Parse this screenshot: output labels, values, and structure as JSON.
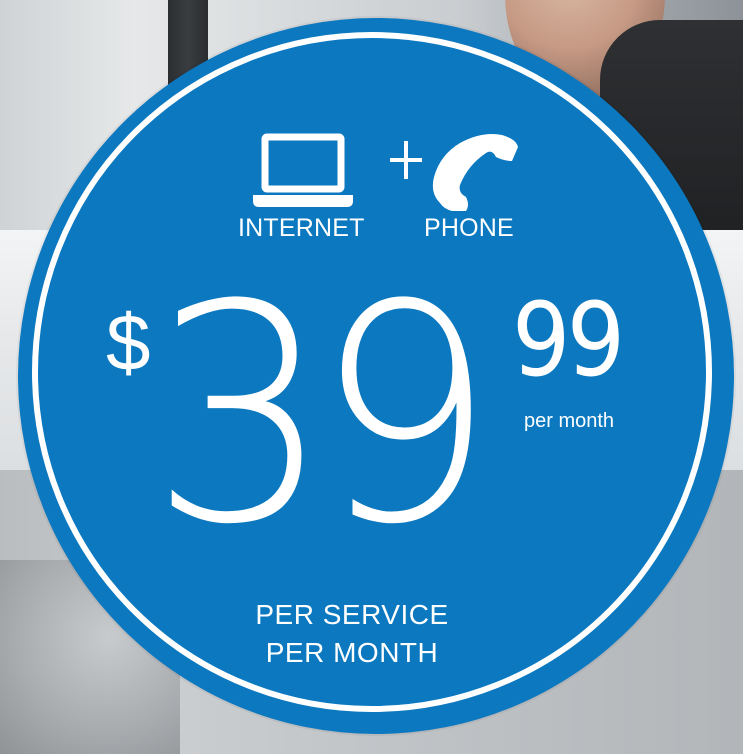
{
  "badge": {
    "icon_left": "laptop-icon",
    "icon_right": "phone-icon",
    "plus_sign": "+",
    "label_left": "INTERNET",
    "label_right": "PHONE",
    "currency": "$",
    "price_whole": "39",
    "price_cents": "99",
    "price_period": "per month",
    "footer_line1": "PER SERVICE",
    "footer_line2": "PER MONTH"
  },
  "colors": {
    "badge_blue": "#0B78C0",
    "text_white": "#FFFFFF"
  }
}
